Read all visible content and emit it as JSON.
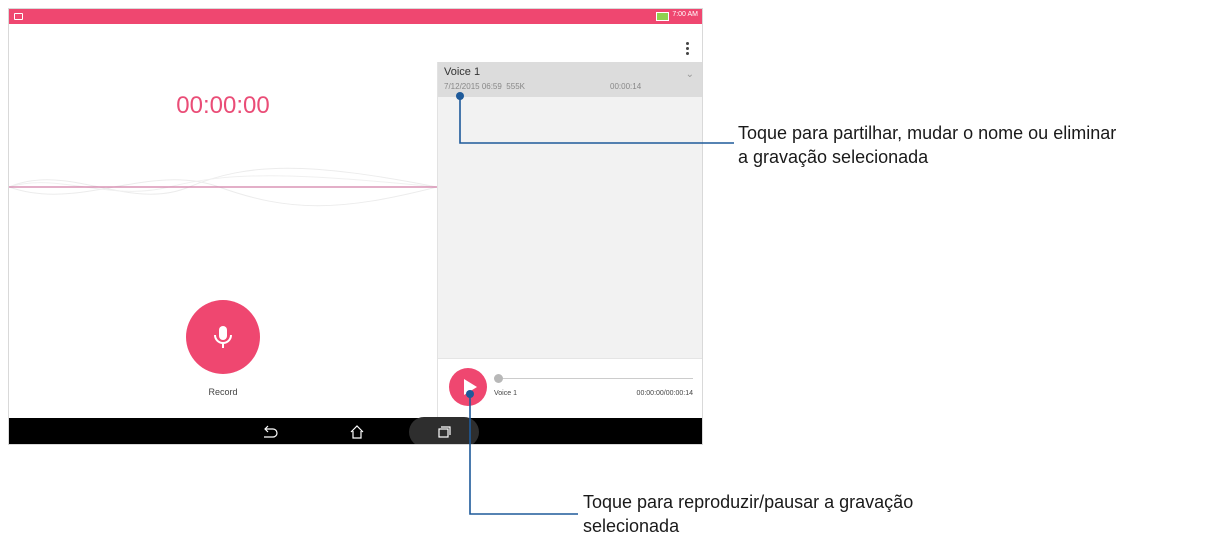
{
  "status_bar": {
    "time": "7:00 AM"
  },
  "recorder": {
    "timer": "00:00:00",
    "record_label": "Record"
  },
  "recordings": [
    {
      "name": "Voice 1",
      "date": "7/12/2015 06:59",
      "size": "555K",
      "duration": "00:00:14"
    }
  ],
  "player": {
    "track_name": "Voice 1",
    "time": "00:00:00/00:00:14"
  },
  "callouts": {
    "top": [
      "Toque para partilhar, mudar o nome ou eliminar",
      "a gravação selecionada"
    ],
    "bottom": [
      "Toque para reproduzir/pausar a gravação",
      "selecionada"
    ]
  },
  "colors": {
    "accent": "#ef4770",
    "timer": "#ea4d77",
    "callout_line": "#1e5a9a"
  },
  "icons": [
    "overflow-menu-icon",
    "microphone-icon",
    "play-icon",
    "back-icon",
    "home-icon",
    "recents-icon",
    "battery-icon",
    "notification-icon",
    "chevron-down-icon"
  ]
}
